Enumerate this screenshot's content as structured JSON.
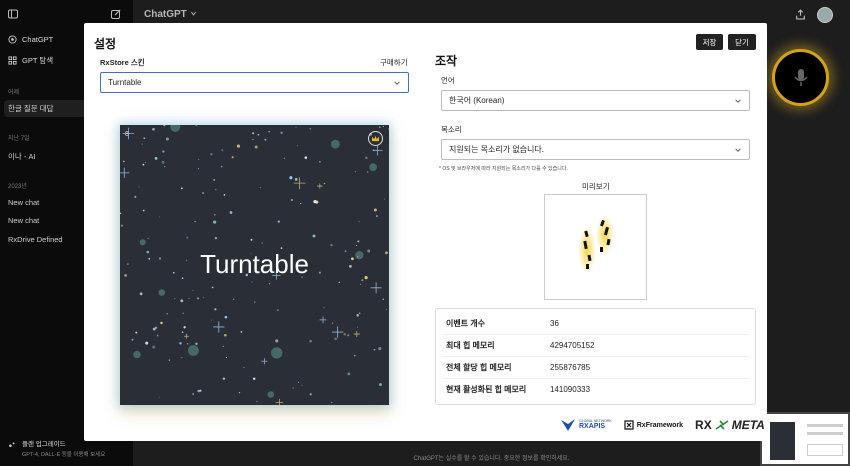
{
  "app": {
    "title": "ChatGPT",
    "footer_note": "ChatGPT는 실수를 할 수 있습니다. 중요한 정보를 확인하세요."
  },
  "sidebar": {
    "new_chat_icon": "edit-icon",
    "items": [
      {
        "label": "ChatGPT",
        "icon": "chatgpt-logo-icon"
      },
      {
        "label": "GPT 탐색",
        "icon": "grid-icon"
      }
    ],
    "sections": [
      {
        "title": "어제",
        "chats": [
          "한글 질문 대답"
        ]
      },
      {
        "title": "지난 7일",
        "chats": [
          "이나 - AI"
        ]
      },
      {
        "title": "2023년",
        "chats": [
          "New chat",
          "New chat",
          "RxDrive Defined"
        ]
      }
    ],
    "upgrade": {
      "label": "플랜 업그레이드",
      "sub": "GPT-4, DALL·E 등을 이용해 보세요"
    }
  },
  "modal": {
    "title": "설정",
    "save_label": "저장",
    "close_label": "닫기",
    "skin": {
      "label": "RxStore 스킨",
      "buy_label": "구매하기",
      "selected": "Turntable",
      "card_number": "8",
      "card_name": "Turntable"
    },
    "controls": {
      "title": "조작",
      "language_label": "언어",
      "language_value": "한국어 (Korean)",
      "voice_label": "목소리",
      "voice_value": "지원되는 목소리가 없습니다.",
      "voice_note": "* OS 및 브라우저에 따라 지원되는 목소리가 다를 수 있습니다.",
      "preview_label": "미리보기"
    },
    "stats": [
      {
        "label": "이벤트 개수",
        "value": "36"
      },
      {
        "label": "최대 힙 메모리",
        "value": "4294705152"
      },
      {
        "label": "전체 할당 힙 메모리",
        "value": "255876785"
      },
      {
        "label": "현재 활성화된 힙 메모리",
        "value": "141090333"
      }
    ],
    "logos": {
      "rxapis": "RXAPIS",
      "rxapis_sub": "GLOBAL NETWORK",
      "rxframework": "RxFramework",
      "rx": "RX",
      "meta": "META"
    }
  },
  "colors": {
    "accent_blue": "#3b6fd1",
    "mic_glow": "#d4a21a",
    "card_bg": "#2a2f37"
  }
}
